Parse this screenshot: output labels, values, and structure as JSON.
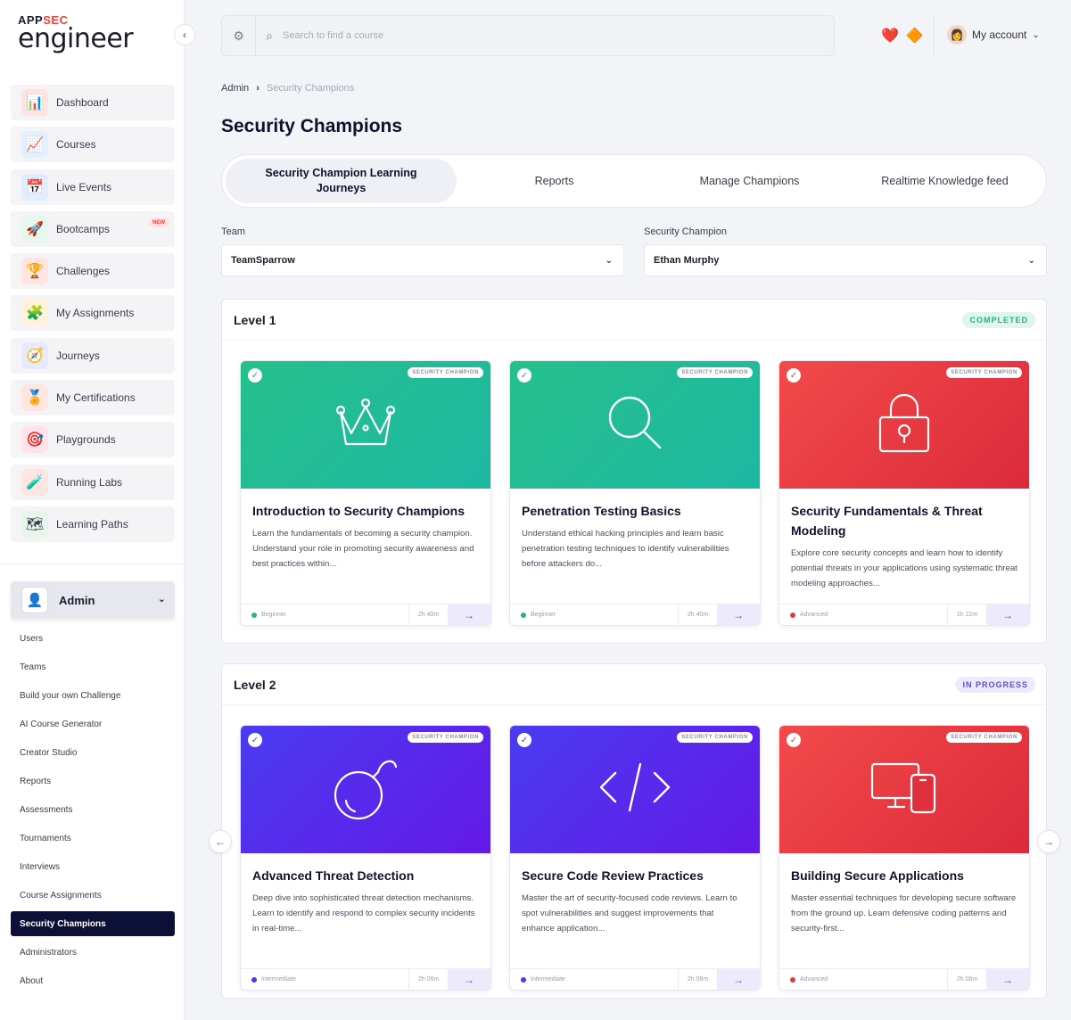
{
  "logo": {
    "top_prefix": "APP",
    "top_accent": "SEC",
    "main": "engineer"
  },
  "sidebar": {
    "collapse_icon": "‹",
    "items": [
      {
        "label": "Dashboard",
        "icon": "📊",
        "bg": "#ffe3e0"
      },
      {
        "label": "Courses",
        "icon": "📈",
        "bg": "#e2f0ff"
      },
      {
        "label": "Live Events",
        "icon": "📅",
        "bg": "#e2ecff"
      },
      {
        "label": "Bootcamps",
        "icon": "🚀",
        "bg": "#e6f7ec",
        "badge": "NEW"
      },
      {
        "label": "Challenges",
        "icon": "🏆",
        "bg": "#ffe5e2"
      },
      {
        "label": "My Assignments",
        "icon": "🧩",
        "bg": "#fff1dc"
      },
      {
        "label": "Journeys",
        "icon": "🧭",
        "bg": "#e6e9ff"
      },
      {
        "label": "My Certifications",
        "icon": "🏅",
        "bg": "#ffe7e0"
      },
      {
        "label": "Playgrounds",
        "icon": "🎯",
        "bg": "#ffe2ea"
      },
      {
        "label": "Running Labs",
        "icon": "🧪",
        "bg": "#fde6e0"
      },
      {
        "label": "Learning Paths",
        "icon": "🗺",
        "bg": "#e7f6ea"
      }
    ],
    "admin": {
      "label": "Admin",
      "icon": "👤",
      "chevron": "⌄"
    },
    "admin_items": [
      {
        "label": "Users"
      },
      {
        "label": "Teams"
      },
      {
        "label": "Build your own Challenge"
      },
      {
        "label": "AI Course Generator"
      },
      {
        "label": "Creator Studio"
      },
      {
        "label": "Reports"
      },
      {
        "label": "Assessments"
      },
      {
        "label": "Tournaments"
      },
      {
        "label": "Interviews"
      },
      {
        "label": "Course Assignments"
      },
      {
        "label": "Security Champions",
        "active": true
      },
      {
        "label": "Administrators"
      },
      {
        "label": "About"
      }
    ]
  },
  "topbar": {
    "filter_icon": "⚙",
    "search_icon": "⌕",
    "search_placeholder": "Search to find a course",
    "icons": [
      "❤️",
      "🔶"
    ],
    "account_avatar": "👩",
    "account_label": "My account",
    "account_chevron": "⌄"
  },
  "breadcrumb": {
    "root": "Admin",
    "separator": "›",
    "current": "Security Champions"
  },
  "page_title": "Security Champions",
  "tabs": [
    {
      "label": "Security Champion Learning Journeys",
      "active": true
    },
    {
      "label": "Reports"
    },
    {
      "label": "Manage Champions"
    },
    {
      "label": "Realtime Knowledge feed"
    }
  ],
  "filters": {
    "team": {
      "label": "Team",
      "value": "TeamSparrow"
    },
    "champion": {
      "label": "Security Champion",
      "value": "Ethan Murphy"
    }
  },
  "levels": [
    {
      "title": "Level 1",
      "status": "COMPLETED",
      "cards": [
        {
          "title": "Introduction to Security Champions",
          "desc": "Learn the fundamentals of becoming a security champion. Understand your role in promoting security awareness and best practices within...",
          "tag": "SECURITY CHAMPION",
          "level": "Beginner",
          "time": "2h 40m",
          "theme": "green",
          "icon": "crown"
        },
        {
          "title": "Penetration Testing Basics",
          "desc": "Understand ethical hacking principles and learn basic penetration testing techniques to identify vulnerabilities before attackers do...",
          "tag": "SECURITY CHAMPION",
          "level": "Beginner",
          "time": "2h 40m",
          "theme": "green",
          "icon": "search"
        },
        {
          "title": "Security Fundamentals & Threat Modeling",
          "desc": "Explore core security concepts and learn how to identify potential threats in your applications using systematic threat modeling approaches...",
          "tag": "SECURITY CHAMPION",
          "level": "Advanced",
          "time": "1h 22m",
          "theme": "red",
          "icon": "lock"
        }
      ]
    },
    {
      "title": "Level 2",
      "status": "IN PROGRESS",
      "cards": [
        {
          "title": "Advanced Threat Detection",
          "desc": "Deep dive into sophisticated threat detection mechanisms. Learn to identify and respond to complex security incidents in real-time...",
          "tag": "SECURITY CHAMPION",
          "level": "Intermediate",
          "time": "2h 06m",
          "theme": "purple",
          "icon": "bomb"
        },
        {
          "title": "Secure Code Review Practices",
          "desc": "Master the art of security-focused code reviews. Learn to spot vulnerabilities and suggest improvements that enhance application...",
          "tag": "SECURITY CHAMPION",
          "level": "Intermediate",
          "time": "2h 06m",
          "theme": "purple",
          "icon": "code"
        },
        {
          "title": "Building Secure Applications",
          "desc": "Master essential techniques for developing secure software from the ground up. Learn defensive coding patterns and security-first...",
          "tag": "SECURITY CHAMPION",
          "level": "Advanced",
          "time": "2h 06m",
          "theme": "red",
          "icon": "devices"
        }
      ]
    }
  ],
  "carousel": {
    "prev": "←",
    "next": "→"
  },
  "card_arrow": "→",
  "check_glyph": "✓"
}
